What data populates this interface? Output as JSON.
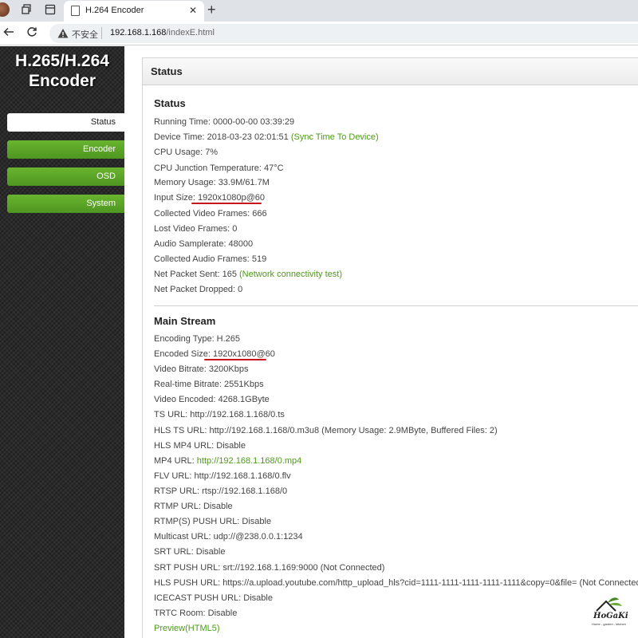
{
  "browser": {
    "tab_title": "H.264 Encoder",
    "insecure_label": "不安全",
    "url_host": "192.168.1.168",
    "url_path": "/indexE.html"
  },
  "sidebar": {
    "brand_line1": "H.265/H.264",
    "brand_line2": "Encoder",
    "items": [
      {
        "label": "Status",
        "active": true
      },
      {
        "label": "Encoder",
        "active": false
      },
      {
        "label": "OSD",
        "active": false
      },
      {
        "label": "System",
        "active": false
      }
    ]
  },
  "panel": {
    "header": "Status"
  },
  "status": {
    "title": "Status",
    "running_time": "Running Time: 0000-00-00 03:39:29",
    "device_time": "Device Time: 2018-03-23 02:01:51 ",
    "sync_link": "(Sync Time To Device)",
    "cpu_usage": "CPU Usage: 7%",
    "cpu_temp": "CPU Junction Temperature: 47°C",
    "memory": "Memory Usage: 33.9M/61.7M",
    "input_size_label": "Input Size: ",
    "input_size_value": "1920x1080p@60",
    "collected_video": "Collected Video Frames: 666",
    "lost_video": "Lost Video Frames: 0",
    "audio_samplerate": "Audio Samplerate: 48000",
    "collected_audio": "Collected Audio Frames: 519",
    "net_sent": "Net Packet Sent: 165 ",
    "net_test_link": "(Network connectivity test)",
    "net_dropped": "Net Packet Dropped: 0"
  },
  "main_stream": {
    "title": "Main Stream",
    "encoding_type": "Encoding Type: H.265",
    "encoded_size_label": "Encoded Size: ",
    "encoded_size_value": "1920x1080@60",
    "video_bitrate": "Video Bitrate: 3200Kbps",
    "realtime_bitrate": "Real-time Bitrate: 2551Kbps",
    "video_encoded": "Video Encoded: 4268.1GByte",
    "ts_url": "TS URL: http://192.168.1.168/0.ts",
    "hls_ts_url": "HLS TS URL: http://192.168.1.168/0.m3u8  (Memory Usage: 2.9MByte, Buffered Files: 2)",
    "hls_mp4_url": "HLS MP4 URL: Disable",
    "mp4_url_label": "MP4 URL: ",
    "mp4_url_link": "http://192.168.1.168/0.mp4",
    "flv_url": "FLV URL: http://192.168.1.168/0.flv",
    "rtsp_url": "RTSP URL: rtsp://192.168.1.168/0",
    "rtmp_url": "RTMP URL: Disable",
    "rtmps_push": "RTMP(S) PUSH URL: Disable",
    "multicast_url": "Multicast URL: udp://@238.0.0.1:1234",
    "srt_url": "SRT URL: Disable",
    "srt_push": "SRT PUSH URL:  srt://192.168.1.169:9000 (Not Connected)",
    "hls_push": "HLS PUSH URL:  https://a.upload.youtube.com/http_upload_hls?cid=1111-1111-1111-1111-1111&copy=0&file= (Not Connected)",
    "icecast_push": "ICECAST PUSH URL: Disable",
    "trtc_room": "TRTC Room: Disable",
    "preview_link": "Preview(HTML5)"
  },
  "watermark": {
    "name": "HoGaKi",
    "tagline": "Home - garden - kitchen"
  },
  "colors": {
    "accent_green": "#5aa626",
    "link_green": "#4e9a19",
    "highlight_red": "#c8161d",
    "sidebar_bg": "#2a2a2a"
  }
}
